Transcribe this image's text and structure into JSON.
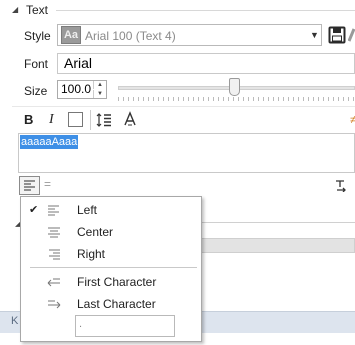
{
  "section": {
    "title": "Text",
    "toggle_glyph": "◢"
  },
  "style_row": {
    "label": "Style",
    "preview_glyph": "Aa",
    "value": "Arial 100 (Text 4)",
    "arrow": "▼"
  },
  "font_row": {
    "label": "Font",
    "value": "Arial"
  },
  "size_row": {
    "label": "Size",
    "value": "100.0",
    "up": "▲",
    "down": "▼",
    "slider_fraction": 0.49
  },
  "format_toolbar": {
    "bold": "B",
    "italic": "I",
    "edge_glyph": "≠"
  },
  "text_area": {
    "content": "aaaaaAaaa"
  },
  "align_toolbar": {
    "eq_glyph": "="
  },
  "align_menu": {
    "items": [
      {
        "label": "Left",
        "checked": true,
        "check": "✔",
        "icon": "align-left-icon"
      },
      {
        "label": "Center",
        "checked": false,
        "check": "",
        "icon": "align-center-icon"
      },
      {
        "label": "Right",
        "checked": false,
        "check": "",
        "icon": "align-right-icon"
      },
      {
        "label": "First Character",
        "checked": false,
        "check": "",
        "icon": "align-first-character-icon"
      },
      {
        "label": "Last Character",
        "checked": false,
        "check": "",
        "icon": "align-last-character-icon"
      }
    ],
    "input_value": "."
  },
  "background": {
    "toggle_glyph": "◢",
    "footer_text": "K"
  },
  "colors": {
    "selection": "#3e8fe6",
    "footer": "#dde4ee",
    "save_icon": "#2a2a2a"
  }
}
